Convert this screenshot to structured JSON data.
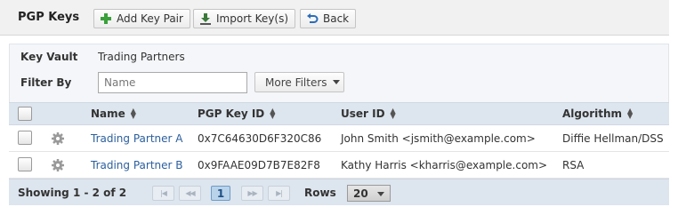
{
  "header": {
    "title": "PGP Keys",
    "add_label": "Add Key Pair",
    "import_label": "Import Key(s)",
    "back_label": "Back"
  },
  "filter": {
    "vault_label": "Key Vault",
    "vault_value": "Trading Partners",
    "filter_by_label": "Filter By",
    "name_placeholder": "Name",
    "name_value": "",
    "more_filters_label": "More Filters"
  },
  "table": {
    "columns": [
      "Name",
      "PGP Key ID",
      "User ID",
      "Algorithm"
    ],
    "rows": [
      {
        "name": "Trading Partner A",
        "key_id": "0x7C64630D6F320C86",
        "user_id": "John Smith <jsmith@example.com>",
        "algorithm": "Diffie Hellman/DSS"
      },
      {
        "name": "Trading Partner B",
        "key_id": "0x9FAAE09D7B7E82F8",
        "user_id": "Kathy Harris <kharris@example.com>",
        "algorithm": "RSA"
      }
    ]
  },
  "footer": {
    "showing": "Showing 1 - 2 of 2",
    "current_page": "1",
    "rows_label": "Rows",
    "rows_value": "20"
  },
  "colors": {
    "link": "#2b5f9e",
    "header_band": "#dde5ee",
    "add_icon": "#3aa03a",
    "back_icon": "#2b6cb8"
  },
  "icons": {
    "add": "plus-icon",
    "import": "download-icon",
    "back": "back-arrow-icon",
    "row_settings": "gear-icon",
    "sort": "sort-icon"
  }
}
